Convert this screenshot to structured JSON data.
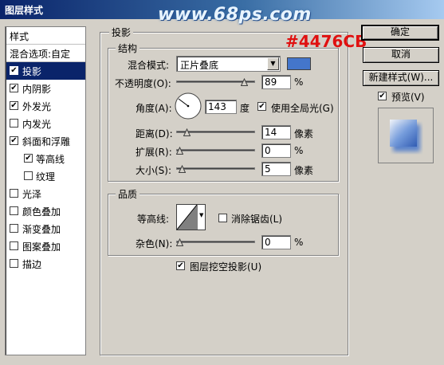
{
  "window": {
    "title": "图层样式"
  },
  "overlay": {
    "watermark": "www.68ps.com",
    "hex_label": "#4476CB"
  },
  "sidebar": {
    "header": "样式",
    "blend_options": "混合选项:自定",
    "items": [
      {
        "label": "投影",
        "checked": true,
        "selected": true
      },
      {
        "label": "内阴影",
        "checked": true
      },
      {
        "label": "外发光",
        "checked": true
      },
      {
        "label": "内发光",
        "checked": false
      },
      {
        "label": "斜面和浮雕",
        "checked": true
      },
      {
        "label": "等高线",
        "checked": true,
        "sub": true
      },
      {
        "label": "纹理",
        "checked": false,
        "sub": true
      },
      {
        "label": "光泽",
        "checked": false
      },
      {
        "label": "颜色叠加",
        "checked": false
      },
      {
        "label": "渐变叠加",
        "checked": false
      },
      {
        "label": "图案叠加",
        "checked": false
      },
      {
        "label": "描边",
        "checked": false
      }
    ]
  },
  "panel": {
    "title": "投影",
    "structure": {
      "title": "结构",
      "blend_mode_label": "混合模式:",
      "blend_mode_value": "正片叠底",
      "color": "#4476CB",
      "opacity_label": "不透明度(O):",
      "opacity_value": "89",
      "opacity_unit": "%",
      "opacity_level": 0.89,
      "angle_label": "角度(A):",
      "angle_value": "143",
      "angle_unit": "度",
      "global_light_label": "使用全局光(G)",
      "global_light_checked": true,
      "distance_label": "距离(D):",
      "distance_value": "14",
      "distance_unit": "像素",
      "distance_level": 0.1,
      "spread_label": "扩展(R):",
      "spread_value": "0",
      "spread_unit": "%",
      "spread_level": 0,
      "size_label": "大小(S):",
      "size_value": "5",
      "size_unit": "像素",
      "size_level": 0.03
    },
    "quality": {
      "title": "品质",
      "contour_label": "等高线:",
      "antialias_label": "消除锯齿(L)",
      "antialias_checked": false,
      "noise_label": "杂色(N):",
      "noise_value": "0",
      "noise_unit": "%",
      "noise_level": 0
    },
    "knockout_label": "图层挖空投影(U)",
    "knockout_checked": true
  },
  "buttons": {
    "ok": "确定",
    "cancel": "取消",
    "new_style": "新建样式(W)...",
    "preview_label": "预览(V)",
    "preview_checked": true
  }
}
